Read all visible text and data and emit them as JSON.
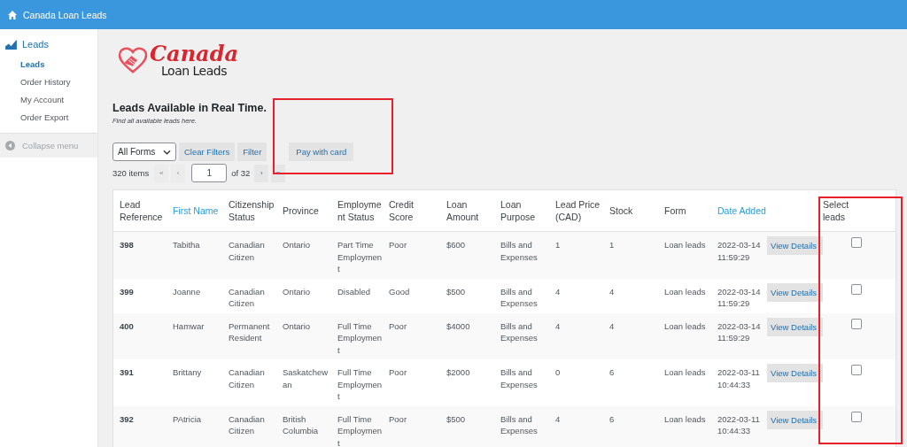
{
  "top_bar": {
    "title": "Canada Loan Leads"
  },
  "sidebar": {
    "section": "Leads",
    "items": [
      {
        "label": "Leads",
        "selected": true
      },
      {
        "label": "Order History",
        "selected": false
      },
      {
        "label": "My Account",
        "selected": false
      },
      {
        "label": "Order Export",
        "selected": false
      }
    ],
    "collapse": "Collapse menu"
  },
  "logo": {
    "top": "Canada",
    "bottom": "Loan Leads"
  },
  "heading": "Leads Available in Real Time.",
  "subheading": "Find all available leads here.",
  "filters": {
    "form_select": "All Forms",
    "clear": "Clear Filters",
    "filter": "Filter",
    "pay": {
      "label": "Pay with card",
      "highlighted": true
    }
  },
  "pagination": {
    "count": "320 items",
    "buttons": [
      {
        "label": "«",
        "disabled": true
      },
      {
        "label": "‹",
        "disabled": true
      }
    ],
    "page": "1",
    "of": "of 32",
    "next_buttons": [
      {
        "label": "›",
        "disabled": false
      },
      {
        "label": "»",
        "disabled": false
      }
    ]
  },
  "table": {
    "columns": [
      {
        "label": "Lead Reference",
        "sortable": false
      },
      {
        "label": "First Name",
        "sortable": true
      },
      {
        "label": "Citizenship Status",
        "sortable": false
      },
      {
        "label": "Province",
        "sortable": false
      },
      {
        "label": "Employment Status",
        "sortable": false
      },
      {
        "label": "Credit Score",
        "sortable": false
      },
      {
        "label": "Loan Amount",
        "sortable": false
      },
      {
        "label": "Loan Purpose",
        "sortable": false
      },
      {
        "label": "Lead Price (CAD)",
        "sortable": false
      },
      {
        "label": "Stock",
        "sortable": false
      },
      {
        "label": "Form",
        "sortable": false
      },
      {
        "label": "Date Added",
        "sortable": true
      },
      {
        "label": "Select leads",
        "sortable": false,
        "highlighted": true
      }
    ],
    "rows": [
      {
        "cells": [
          "398",
          "Tabitha",
          "Canadian Citizen",
          "Ontario",
          "Part Time Employment",
          "Poor",
          "$600",
          "Bills and Expenses",
          "1",
          "1",
          "Loan leads",
          "2022-03-14 11:59:29"
        ],
        "action": "View Details",
        "checked": false
      },
      {
        "cells": [
          "399",
          "Joanne",
          "Canadian Citizen",
          "Ontario",
          "Disabled",
          "Good",
          "$500",
          "Bills and Expenses",
          "4",
          "4",
          "Loan leads",
          "2022-03-14 11:59:29"
        ],
        "action": "View Details",
        "checked": false
      },
      {
        "cells": [
          "400",
          "Hamwar",
          "Permanent Resident",
          "Ontario",
          "Full Time Employment",
          "Poor",
          "$4000",
          "Bills and Expenses",
          "4",
          "4",
          "Loan leads",
          "2022-03-14 11:59:29"
        ],
        "action": "View Details",
        "checked": false
      },
      {
        "cells": [
          "391",
          "Brittany",
          "Canadian Citizen",
          "Saskatchewan",
          "Full Time Employment",
          "Poor",
          "$2000",
          "Bills and Expenses",
          "0",
          "6",
          "Loan leads",
          "2022-03-11 10:44:33"
        ],
        "action": "View Details",
        "checked": false
      },
      {
        "cells": [
          "392",
          "PAtricia",
          "Canadian Citizen",
          "British Columbia",
          "Full Time Employment",
          "Poor",
          "$500",
          "Bills and Expenses",
          "4",
          "6",
          "Loan leads",
          "2022-03-11 10:44:33"
        ],
        "action": "View Details",
        "checked": false
      }
    ]
  }
}
